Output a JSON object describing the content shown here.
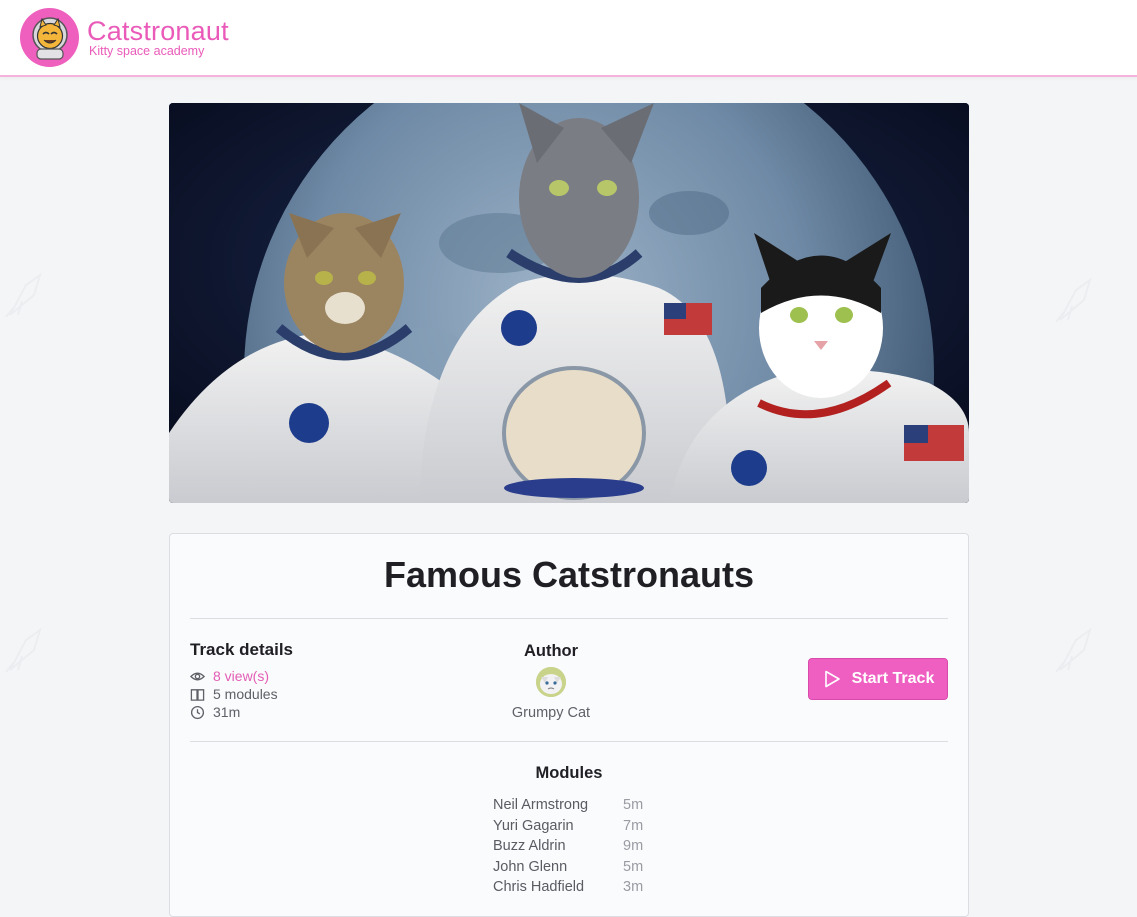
{
  "brand": {
    "name": "Catstronaut",
    "tagline": "Kitty space academy"
  },
  "track": {
    "title": "Famous Catstronauts",
    "details_heading": "Track details",
    "views": "8 view(s)",
    "modules_count": "5 modules",
    "duration": "31m",
    "author_heading": "Author",
    "author_name": "Grumpy Cat",
    "start_button": "Start Track",
    "modules_heading": "Modules",
    "modules": [
      {
        "name": "Neil Armstrong",
        "length": "5m"
      },
      {
        "name": "Yuri Gagarin",
        "length": "7m"
      },
      {
        "name": "Buzz Aldrin",
        "length": "9m"
      },
      {
        "name": "John Glenn",
        "length": "5m"
      },
      {
        "name": "Chris Hadfield",
        "length": "3m"
      }
    ]
  },
  "icons": {
    "views": "eye-icon",
    "modules": "book-icon",
    "duration": "clock-icon",
    "start": "play-icon"
  },
  "colors": {
    "brand_pink": "#ea5bb9",
    "button_pink": "#ef5fc1",
    "background": "#f4f5f7"
  }
}
